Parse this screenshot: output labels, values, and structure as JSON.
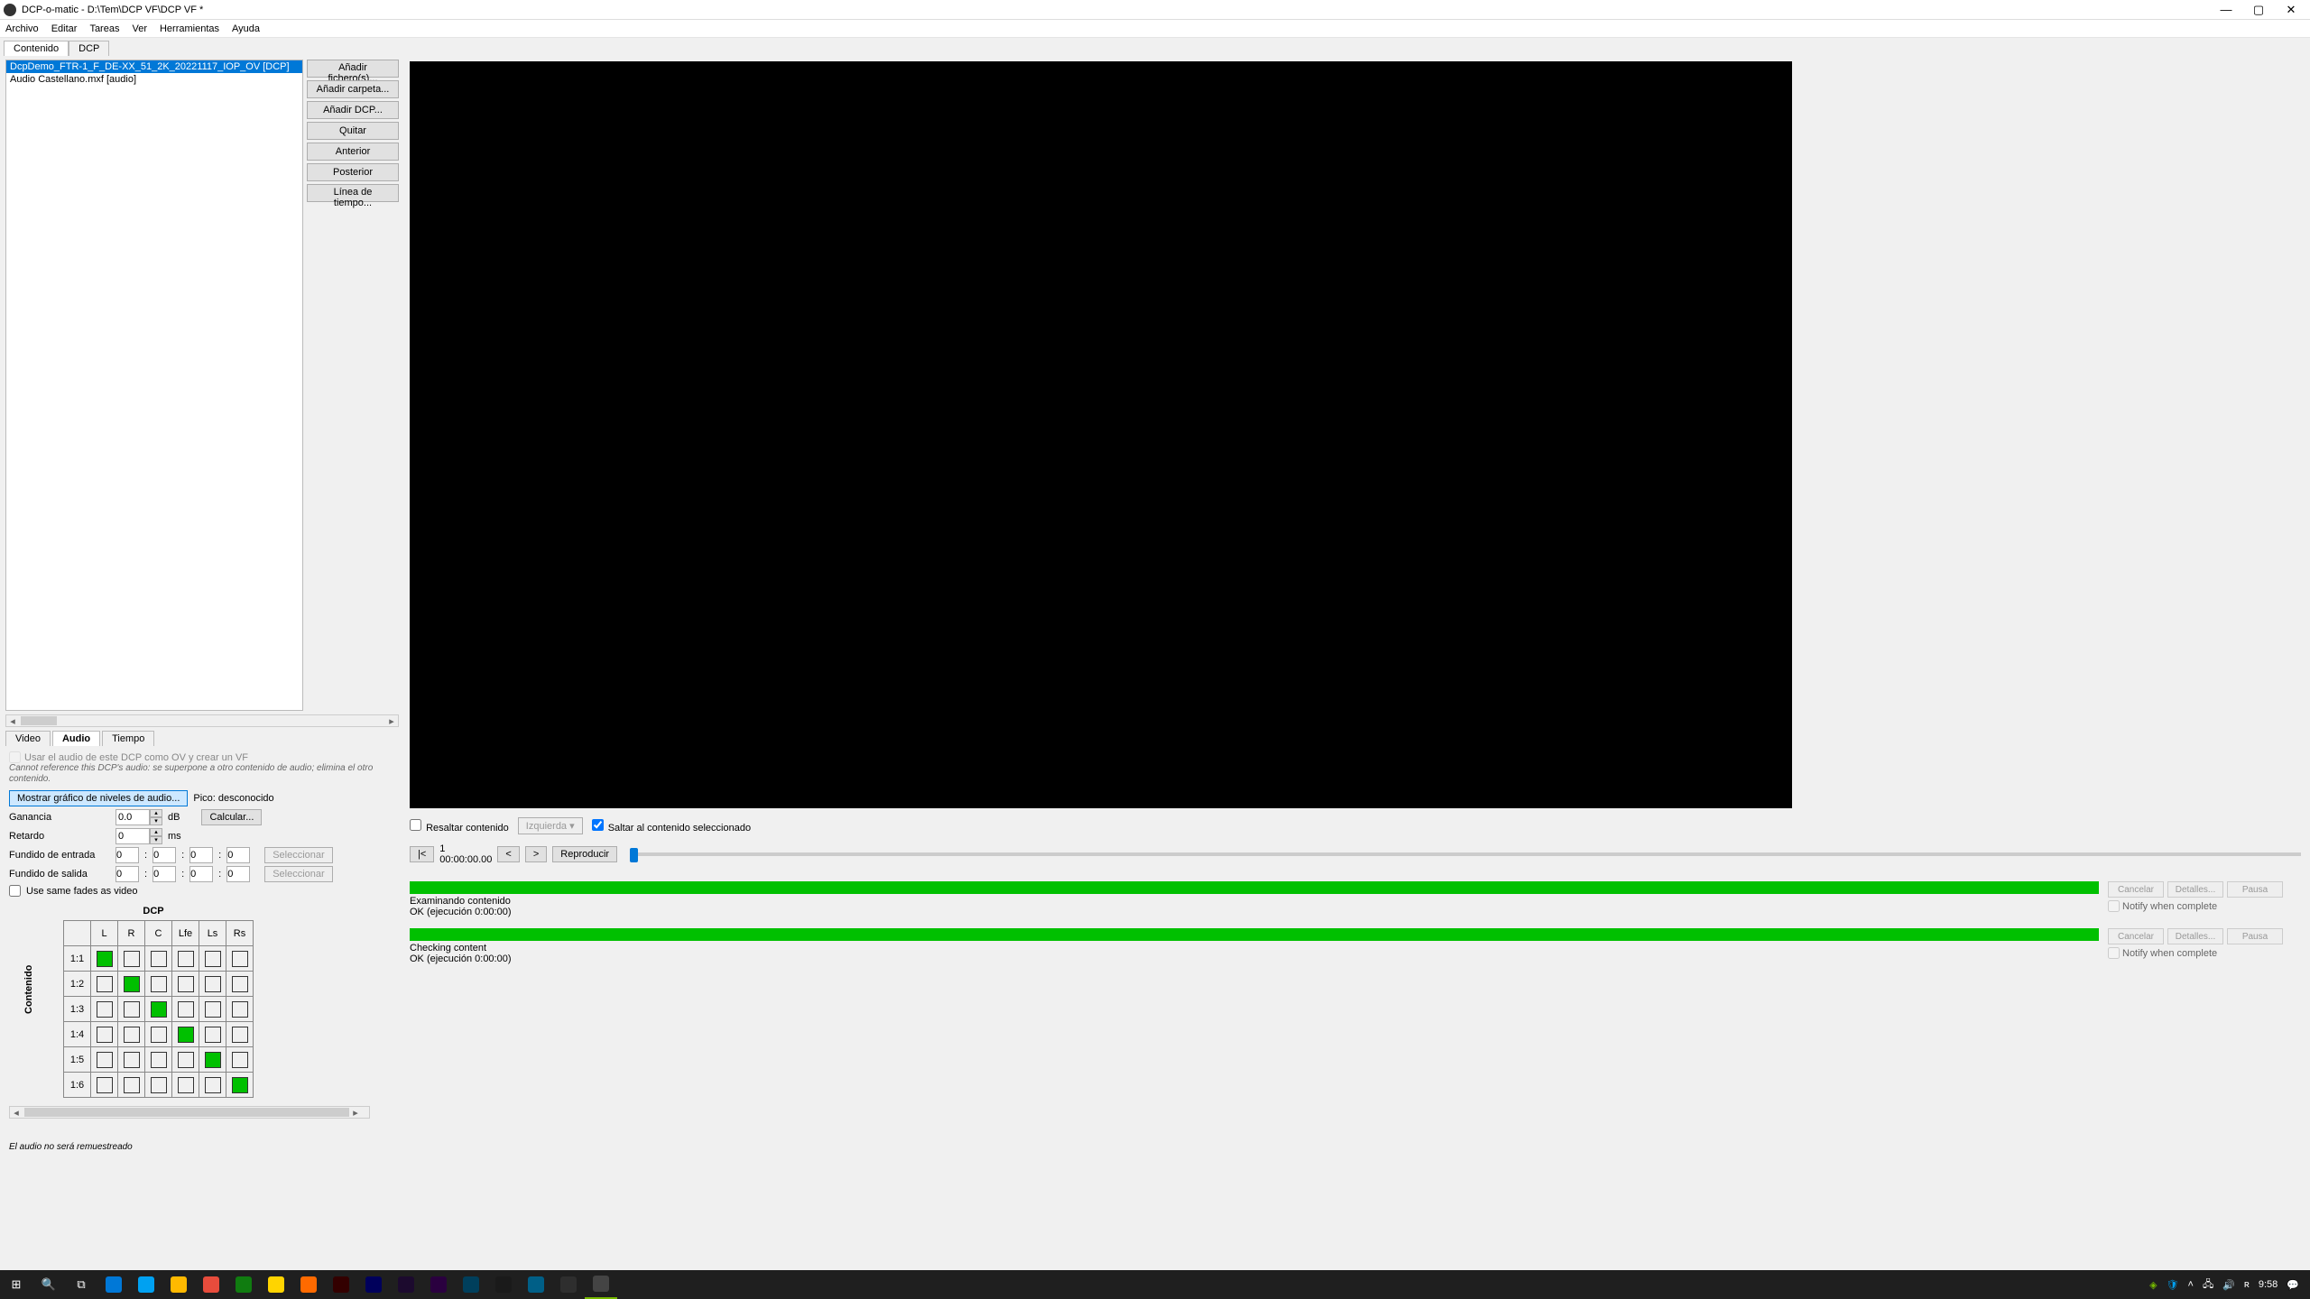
{
  "window": {
    "title": "DCP-o-matic - D:\\Tem\\DCP VF\\DCP VF *"
  },
  "menu": [
    "Archivo",
    "Editar",
    "Tareas",
    "Ver",
    "Herramientas",
    "Ayuda"
  ],
  "topTabs": {
    "active": "Contenido",
    "inactive": "DCP"
  },
  "contentList": [
    "DcpDemo_FTR-1_F_DE-XX_51_2K_20221117_IOP_OV [DCP]",
    "Audio Castellano.mxf [audio]"
  ],
  "listButtons": [
    "Añadir fichero(s)...",
    "Añadir carpeta...",
    "Añadir DCP...",
    "Quitar",
    "Anterior",
    "Posterior",
    "Línea de tiempo..."
  ],
  "propTabs": [
    "Video",
    "Audio",
    "Tiempo"
  ],
  "audio": {
    "useOvLabel": "Usar el audio de este DCP como OV y crear un VF",
    "note": "Cannot reference this DCP's audio: se superpone a otro contenido de audio; elimina el otro contenido.",
    "showGraphBtn": "Mostrar gráfico de niveles de audio...",
    "peakLabel": "Pico: desconocido",
    "gainLabel": "Ganancia",
    "gainValue": "0.0",
    "gainUnit": "dB",
    "calcBtn": "Calcular...",
    "delayLabel": "Retardo",
    "delayValue": "0",
    "delayUnit": "ms",
    "fadeInLabel": "Fundido de entrada",
    "fadeOutLabel": "Fundido de salida",
    "fadeVals": [
      "0",
      "0",
      "0",
      "0"
    ],
    "selectBtn": "Seleccionar",
    "sameFadesLabel": "Use same fades as video",
    "matrixTitle": "DCP",
    "cols": [
      "L",
      "R",
      "C",
      "Lfe",
      "Ls",
      "Rs"
    ],
    "rows": [
      "1:1",
      "1:2",
      "1:3",
      "1:4",
      "1:5",
      "1:6"
    ],
    "resampleNote": "El audio no será remuestreado"
  },
  "viewer": {
    "highlightLabel": "Resaltar contenido",
    "leftBtn": "Izquierda",
    "jumpLabel": "Saltar al contenido seleccionado",
    "frame": "1",
    "timecode": "00:00:00.00",
    "playBtn": "Reproducir"
  },
  "jobs": [
    {
      "title": "Examinando contenido",
      "status": "OK (ejecución 0:00:00)"
    },
    {
      "title": "Checking content",
      "status": "OK (ejecución 0:00:00)"
    }
  ],
  "jobBtns": {
    "cancel": "Cancelar",
    "details": "Detalles...",
    "pause": "Pausa",
    "notify": "Notify when complete"
  },
  "clock": {
    "time": "9:58",
    "date": ""
  }
}
